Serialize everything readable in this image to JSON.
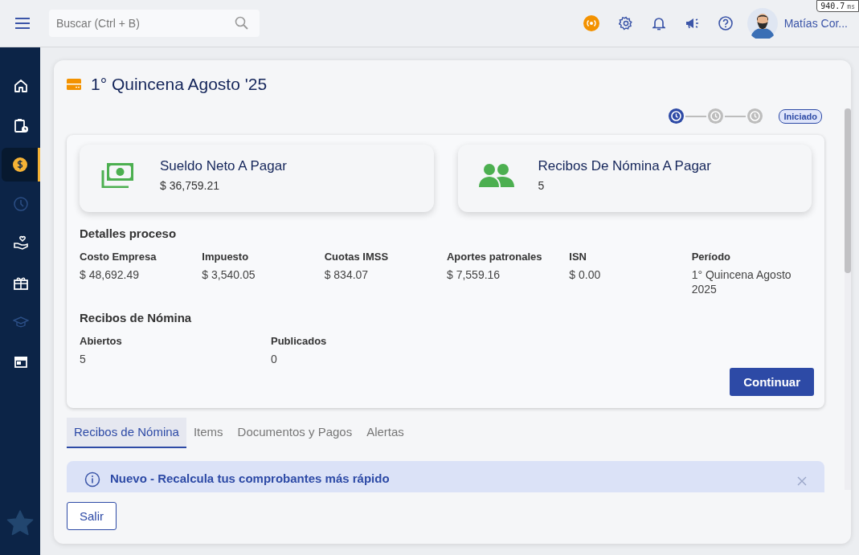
{
  "topbar": {
    "search": {
      "placeholder": "Buscar (Ctrl + B)"
    },
    "user_name": "Matías Cor...",
    "perf_badge": {
      "value": "940.7",
      "unit": "ms"
    }
  },
  "sidebar": {
    "items": [
      {
        "selected": false,
        "disabled": false
      },
      {
        "selected": false,
        "disabled": false
      },
      {
        "selected": true,
        "disabled": false
      },
      {
        "selected": false,
        "disabled": true
      },
      {
        "selected": false,
        "disabled": false
      },
      {
        "selected": false,
        "disabled": false
      },
      {
        "selected": false,
        "disabled": true
      },
      {
        "selected": false,
        "disabled": false
      }
    ]
  },
  "page": {
    "title": "1° Quincena Agosto '25",
    "steps": [
      {
        "active": true
      },
      {
        "active": false
      },
      {
        "active": false
      }
    ],
    "status": "Iniciado",
    "summary_cards": [
      {
        "title": "Sueldo Neto A Pagar",
        "value": "$ 36,759.21"
      },
      {
        "title": "Recibos De Nómina A Pagar",
        "value": "5"
      }
    ],
    "details": {
      "title": "Detalles proceso",
      "fields": [
        {
          "label": "Costo Empresa",
          "value": "$ 48,692.49"
        },
        {
          "label": "Impuesto",
          "value": "$ 3,540.05"
        },
        {
          "label": "Cuotas IMSS",
          "value": "$ 834.07"
        },
        {
          "label": "Aportes patronales",
          "value": "$ 7,559.16"
        },
        {
          "label": "ISN",
          "value": "$ 0.00"
        },
        {
          "label": "Período",
          "value": "1° Quincena Agosto 2025"
        }
      ]
    },
    "receipts": {
      "title": "Recibos de Nómina",
      "fields": [
        {
          "label": "Abiertos",
          "value": "5"
        },
        {
          "label": "Publicados",
          "value": "0"
        }
      ]
    },
    "continue_button": "Continuar",
    "tabs": [
      {
        "label": "Recibos de Nómina",
        "selected": true
      },
      {
        "label": "Items",
        "selected": false
      },
      {
        "label": "Documentos y Pagos",
        "selected": false
      },
      {
        "label": "Alertas",
        "selected": false
      }
    ],
    "alert": {
      "title": "Nuevo - Recalcula tus comprobantes más rápido"
    },
    "exit_button": "Salir"
  }
}
